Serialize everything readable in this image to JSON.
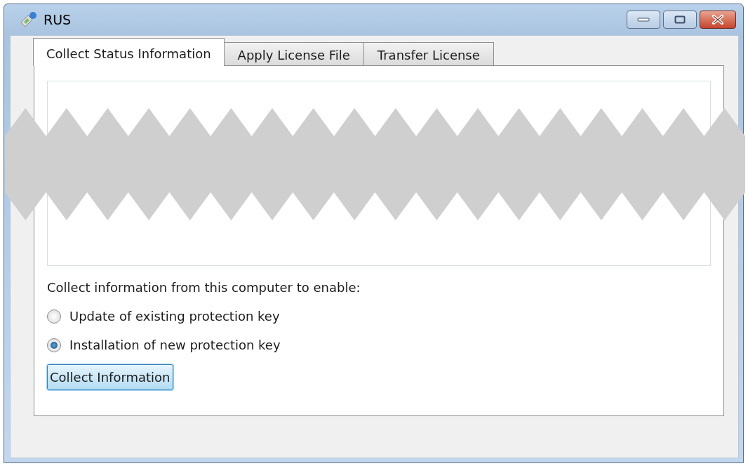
{
  "window": {
    "title": "RUS"
  },
  "tabs": [
    {
      "label": "Collect Status Information",
      "selected": true
    },
    {
      "label": "Apply License File",
      "selected": false
    },
    {
      "label": "Transfer License",
      "selected": false
    }
  ],
  "prompt": "Collect information from this computer to enable:",
  "options": [
    {
      "label": "Update of existing protection key",
      "selected": false
    },
    {
      "label": "Installation of new protection key",
      "selected": true
    }
  ],
  "buttons": [
    "Collect Information"
  ]
}
